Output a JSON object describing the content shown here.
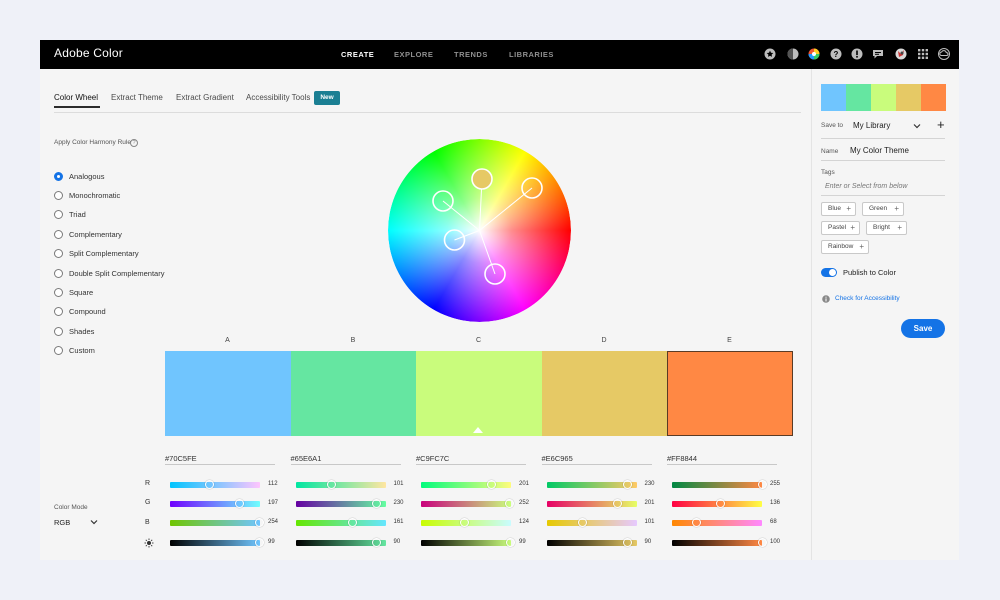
{
  "app": {
    "title": "Adobe Color"
  },
  "nav": {
    "create": "CREATE",
    "explore": "EXPLORE",
    "trends": "TRENDS",
    "libraries": "LIBRARIES"
  },
  "top_icons": [
    "star-icon",
    "moon-icon",
    "color-wheel-icon",
    "help-icon",
    "alert-icon",
    "chat-icon",
    "user-avatar",
    "apps-grid-icon",
    "creative-cloud-icon"
  ],
  "tabs": {
    "color_wheel": "Color Wheel",
    "extract_theme": "Extract Theme",
    "extract_gradient": "Extract Gradient",
    "accessibility_tools": "Accessibility Tools",
    "new_badge": "New"
  },
  "harmony": {
    "title": "Apply Color Harmony Rule",
    "info": "?",
    "selected": "Analogous",
    "rules": [
      "Analogous",
      "Monochromatic",
      "Triad",
      "Complementary",
      "Split Complementary",
      "Double Split Complementary",
      "Square",
      "Compound",
      "Shades",
      "Custom"
    ]
  },
  "colors": [
    {
      "letter": "A",
      "hex": "#70C5FE",
      "color": "#70c5fe",
      "r": 112,
      "g": 197,
      "b": 254,
      "brightness": 99
    },
    {
      "letter": "B",
      "hex": "#65E6A1",
      "color": "#65e6a1",
      "r": 101,
      "g": 230,
      "b": 161,
      "brightness": 90
    },
    {
      "letter": "C",
      "hex": "#C9FC7C",
      "color": "#c9fc7c",
      "r": 201,
      "g": 252,
      "b": 124,
      "brightness": 99
    },
    {
      "letter": "D",
      "hex": "#E6C965",
      "color": "#e6c965",
      "r": 230,
      "g": 201,
      "b": 101,
      "brightness": 90
    },
    {
      "letter": "E",
      "hex": "#FF8844",
      "color": "#ff8844",
      "r": 255,
      "g": 136,
      "b": 68,
      "brightness": 100
    }
  ],
  "selected_swatch": "E",
  "channels": {
    "r": "R",
    "g": "G",
    "b": "B",
    "brightness_icon": "brightness-icon"
  },
  "color_mode": {
    "label": "Color Mode",
    "value": "RGB"
  },
  "right_panel": {
    "save_to_label": "Save to",
    "library": "My Library",
    "add": "+",
    "name_label": "Name",
    "name_value": "My Color Theme",
    "tags_label": "Tags",
    "tags_placeholder": "Enter or Select from below",
    "tags": [
      "Blue",
      "Green",
      "Pastel",
      "Bright",
      "Rainbow"
    ],
    "publish_label": "Publish to Color",
    "publish_on": true,
    "check_accessibility": "Check for Accessibility",
    "save_button": "Save"
  },
  "accent_color": "#1473e6"
}
